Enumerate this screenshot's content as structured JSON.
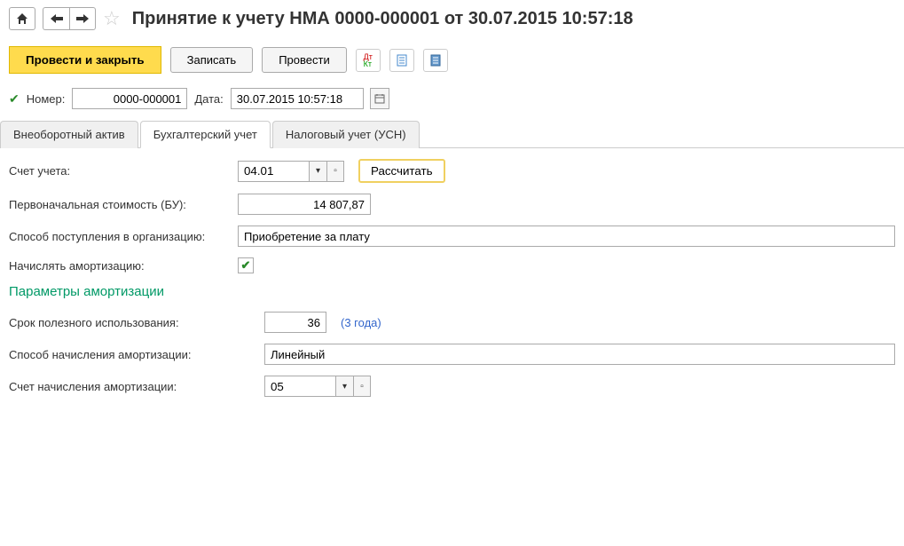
{
  "header": {
    "title": "Принятие к учету НМА 0000-000001 от 30.07.2015 10:57:18"
  },
  "toolbar": {
    "post_and_close": "Провести и закрыть",
    "save": "Записать",
    "post": "Провести"
  },
  "doc_info": {
    "number_label": "Номер:",
    "number_value": "0000-000001",
    "date_label": "Дата:",
    "date_value": "30.07.2015 10:57:18"
  },
  "tabs": {
    "tab1": "Внеоборотный актив",
    "tab2": "Бухгалтерский учет",
    "tab3": "Налоговый учет (УСН)"
  },
  "accounting": {
    "account_label": "Счет учета:",
    "account_value": "04.01",
    "calc_button": "Рассчитать",
    "initial_cost_label": "Первоначальная стоимость (БУ):",
    "initial_cost_value": "14 807,87",
    "receipt_method_label": "Способ поступления в организацию:",
    "receipt_method_value": "Приобретение за плату",
    "amortization_flag_label": "Начислять амортизацию:"
  },
  "amortization": {
    "section_title": "Параметры амортизации",
    "useful_life_label": "Срок полезного использования:",
    "useful_life_value": "36",
    "useful_life_hint": "(3 года)",
    "method_label": "Способ начисления амортизации:",
    "method_value": "Линейный",
    "account_label": "Счет начисления амортизации:",
    "account_value": "05"
  }
}
